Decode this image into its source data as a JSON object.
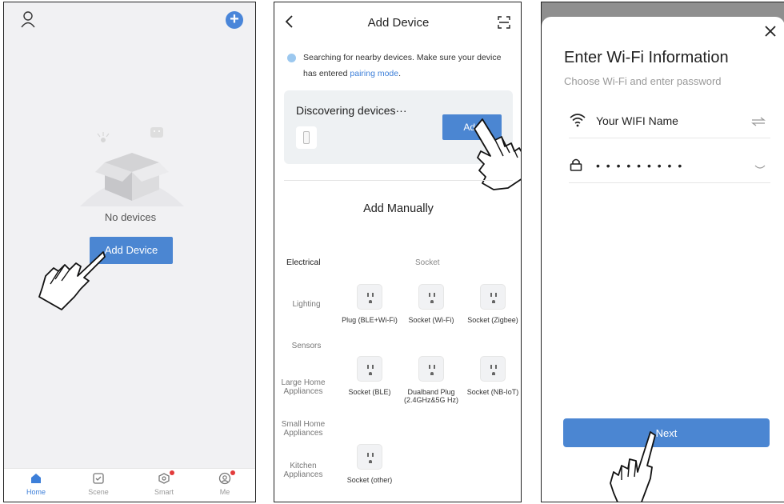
{
  "home": {
    "empty_text": "No devices",
    "add_device_label": "Add Device",
    "nav": [
      {
        "label": "Home",
        "icon": "home-icon",
        "active": true
      },
      {
        "label": "Scene",
        "icon": "scene-icon"
      },
      {
        "label": "Smart",
        "icon": "smart-icon"
      },
      {
        "label": "Me",
        "icon": "me-icon"
      }
    ]
  },
  "add_device": {
    "title": "Add Device",
    "search_text": "Searching for nearby devices. Make sure your device has entered",
    "search_link": "pairing mode",
    "search_end": ".",
    "discover_title": "Discovering devices···",
    "add_label": "Add",
    "manual_title": "Add Manually",
    "socket_header": "Socket",
    "categories": [
      "Electrical",
      "Lighting",
      "Sensors",
      "Large Home Appliances",
      "Small Home Appliances",
      "Kitchen Appliances"
    ],
    "tiles": [
      "Plug (BLE+Wi-Fi)",
      "Socket (Wi-Fi)",
      "Socket (Zigbee)",
      "Socket (BLE)",
      "Dualband Plug (2.4GHz&5G Hz)",
      "Socket (NB-IoT)",
      "Socket (other)"
    ]
  },
  "wifi": {
    "title": "Enter Wi-Fi Information",
    "subtitle": "Choose Wi-Fi and enter password",
    "wifi_name": "Your WIFI Name",
    "password_mask": "• • • • • • • • •",
    "next_label": "Next"
  },
  "colors": {
    "accent": "#4b86d2",
    "badge": "#e23b3b"
  }
}
